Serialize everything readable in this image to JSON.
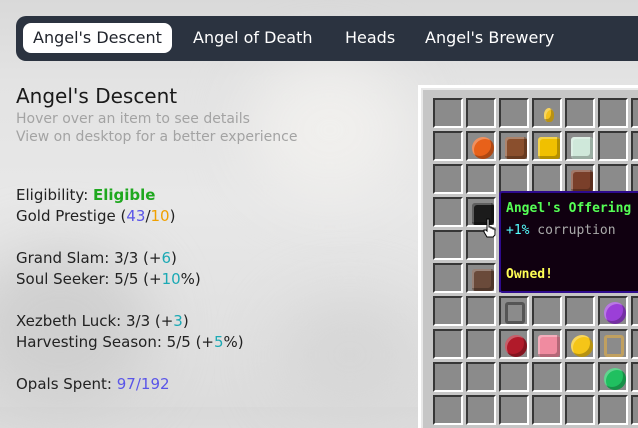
{
  "tabs": [
    {
      "label": "Angel's Descent",
      "active": true
    },
    {
      "label": "Angel of Death",
      "active": false
    },
    {
      "label": "Heads",
      "active": false
    },
    {
      "label": "Angel's Brewery",
      "active": false
    }
  ],
  "info": {
    "title": "Angel's Descent",
    "hint1": "Hover over an item to see details",
    "hint2": "View on desktop for a better experience"
  },
  "stats": {
    "eligibility_label": "Eligibility: ",
    "eligibility_value": "Eligible",
    "gold_label": "Gold Prestige (",
    "gold_current": "43",
    "gold_sep": "/",
    "gold_required": "10",
    "gold_close": ")",
    "grand_slam_label": "Grand Slam: 3/3 (+",
    "grand_slam_bonus": "6",
    "grand_slam_close": ")",
    "soul_seeker_label": "Soul Seeker: 5/5 (+",
    "soul_seeker_bonus": "10",
    "soul_seeker_close": "%)",
    "xezbeth_label": "Xezbeth Luck: 3/3 (+",
    "xezbeth_bonus": "3",
    "xezbeth_close": ")",
    "harvest_label": "Harvesting Season: 5/5 (+",
    "harvest_bonus": "5",
    "harvest_close": "%)",
    "opals_label": "Opals Spent: ",
    "opals_value": "97/192"
  },
  "tooltip": {
    "title": "Angel's Offering",
    "plus": "+1%",
    "line": " corruption",
    "owned": "Owned!"
  },
  "colors": {
    "tab_bar": "#2b3340",
    "eligible": "#1fa81f",
    "blue_value": "#5a55e8",
    "orange_value": "#f0a000",
    "teal_value": "#1ba9b4",
    "tooltip_title": "#55ff55",
    "tooltip_owned": "#ffff55"
  },
  "grid_items": [
    {
      "icon": "golden-shard-icon",
      "color": "#f4c21d"
    },
    {
      "icon": "fruit-icon",
      "color": "#e8611a"
    },
    {
      "icon": "cocoa-beans-icon",
      "color": "#8a4f2d"
    },
    {
      "icon": "golden-helmet-icon",
      "color": "#f0c000"
    },
    {
      "icon": "feather-icon",
      "color": "#cfe8da"
    },
    {
      "icon": "enchanted-book-icon",
      "color": "#7a3f2a"
    },
    {
      "icon": "coal-block-icon",
      "color": "#1b1b1b"
    },
    {
      "icon": "note-block-icon",
      "color": "#6a4a3a"
    },
    {
      "icon": "end-portal-frame-icon",
      "color": "#2a1a3a"
    },
    {
      "icon": "ender-pearl-icon",
      "color": "#1b6b5e"
    },
    {
      "icon": "book-icon",
      "color": "#8a4a2a"
    },
    {
      "icon": "lead-icon",
      "color": "#555555"
    },
    {
      "icon": "ender-eye-icon",
      "color": "#9b3fd8"
    },
    {
      "icon": "redstone-icon",
      "color": "#b11a2a"
    },
    {
      "icon": "pink-wool-icon",
      "color": "#f08ba0"
    },
    {
      "icon": "golden-apple-icon",
      "color": "#f5c518"
    },
    {
      "icon": "tripwire-hook-icon",
      "color": "#c0a060"
    },
    {
      "icon": "emerald-icon",
      "color": "#20c060"
    }
  ]
}
